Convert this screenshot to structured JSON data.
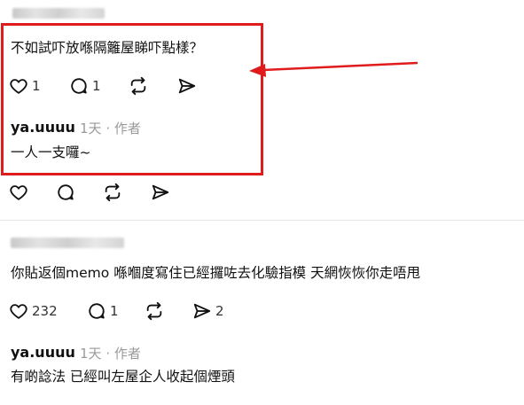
{
  "thread": {
    "post1": {
      "text": "不如試吓放喺隔籬屋睇吓點樣？",
      "likes": "1",
      "replies": "1"
    },
    "reply1": {
      "author": "ya.uuuu",
      "time": "1天",
      "dot": "·",
      "role": "作者",
      "text": "一人一支囉~"
    },
    "post2": {
      "text": "你貼返個memo 喺嗰度寫住已經攞咗去化驗指模 天網恢恢你走唔甩",
      "likes": "232",
      "replies": "1",
      "shares": "2"
    },
    "reply2": {
      "author": "ya.uuuu",
      "time": "1天",
      "dot": "·",
      "role": "作者",
      "text": "有啲諗法 已經叫左屋企人收起個煙頭"
    }
  },
  "annotation": {
    "box_color": "#e01b1b",
    "arrow_color": "#e01b1b"
  }
}
